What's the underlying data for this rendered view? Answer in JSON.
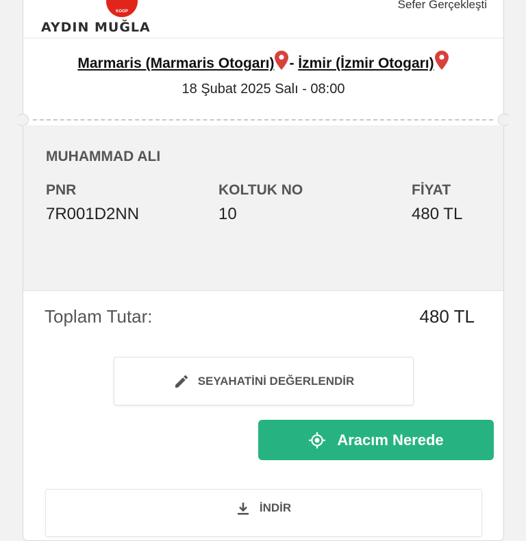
{
  "header": {
    "logo_text": "AYDIN MUĞLA",
    "logo_badge": "KOOP",
    "status": "Sefer Gerçekleşti"
  },
  "route": {
    "origin": "Marmaris (Marmaris Otogarı)",
    "separator": "- ",
    "destination": "İzmir (İzmir Otogarı)",
    "date_time": "18 Şubat 2025 Salı - 08:00"
  },
  "passenger": {
    "name": "MUHAMMAD ALI",
    "pnr_label": "PNR",
    "pnr_value": "7R001D2NN",
    "seat_label": "KOLTUK NO",
    "seat_value": "10",
    "price_label": "FİYAT",
    "price_value": "480 TL"
  },
  "total": {
    "label": "Toplam Tutar:",
    "value": "480 TL"
  },
  "buttons": {
    "rate_label": "SEYAHATİNİ DEĞERLENDİR",
    "where_label": "Aracım Nerede",
    "download_label": "İNDİR"
  },
  "colors": {
    "brand_red": "#e1251b",
    "pin_red": "#d9403b",
    "green_button": "#27b381"
  },
  "icons": {
    "pin": "map-pin-icon",
    "rate": "pencil-icon",
    "where": "location-target-icon",
    "download": "download-icon"
  }
}
